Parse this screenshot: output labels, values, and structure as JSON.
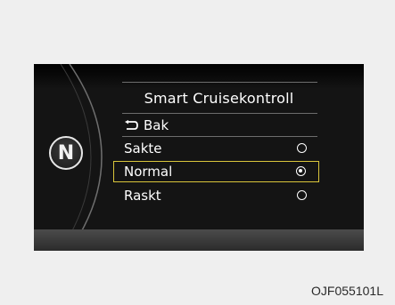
{
  "gear": {
    "letter": "N"
  },
  "menu": {
    "title": "Smart Cruisekontroll",
    "back_label": "Bak",
    "options": [
      {
        "label": "Sakte",
        "selected": false,
        "focused": false
      },
      {
        "label": "Normal",
        "selected": true,
        "focused": true
      },
      {
        "label": "Raskt",
        "selected": false,
        "focused": false
      }
    ]
  },
  "caption": "OJF055101L",
  "colors": {
    "display_bg": "#141414",
    "focus_border": "#d9c53b",
    "text": "#ffffff"
  },
  "icons": {
    "back": "return-arrow-icon",
    "radio": "radio-button-icon"
  }
}
